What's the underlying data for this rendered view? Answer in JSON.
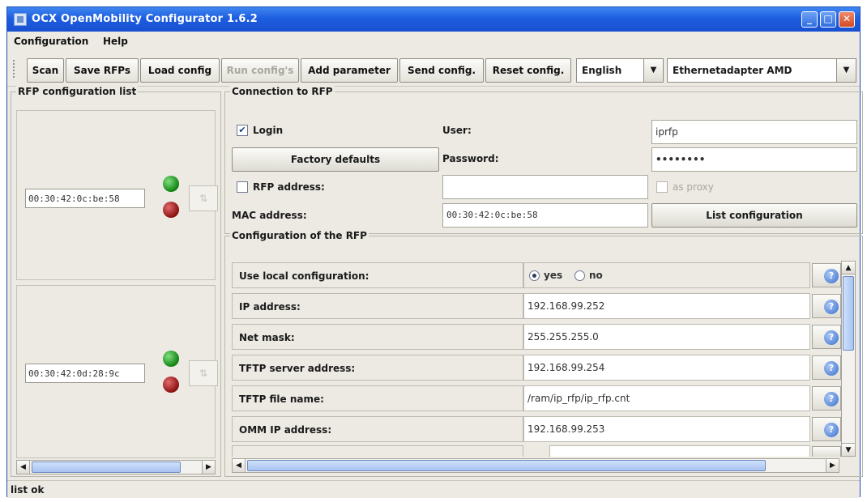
{
  "window": {
    "title": "OCX OpenMobility Configurator 1.6.2",
    "controls": {
      "minimize": "_",
      "maximize": "□",
      "close": "✕"
    }
  },
  "menu": {
    "items": [
      "Configuration",
      "Help"
    ]
  },
  "toolbar": {
    "buttons": [
      {
        "label": "Scan",
        "enabled": true
      },
      {
        "label": "Save RFPs",
        "enabled": true
      },
      {
        "label": "Load config",
        "enabled": true
      },
      {
        "label": "Run config's",
        "enabled": false
      },
      {
        "label": "Add parameter",
        "enabled": true
      },
      {
        "label": "Send config.",
        "enabled": true
      },
      {
        "label": "Reset config.",
        "enabled": true
      }
    ],
    "language": "English",
    "adapter": "Ethernetadapter AMD"
  },
  "rfp_list": {
    "legend": "RFP configuration list",
    "items": [
      {
        "mac": "00:30:42:0c:be:58"
      },
      {
        "mac": "00:30:42:0d:28:9c"
      }
    ]
  },
  "connection": {
    "legend": "Connection to RFP",
    "login_label": "Login",
    "login_checked": true,
    "factory_defaults_label": "Factory defaults",
    "user_label": "User:",
    "user_value": "iprfp",
    "password_label": "Password:",
    "password_value": "••••••••",
    "rfp_address_label": "RFP address:",
    "rfp_address_checked": false,
    "rfp_address_value": "",
    "as_proxy_label": "as proxy",
    "mac_label": "MAC address:",
    "mac_value": "00:30:42:0c:be:58",
    "list_config_label": "List configuration"
  },
  "rfp_config": {
    "legend": "Configuration of the RFP",
    "local_config": {
      "label": "Use local configuration:",
      "yes": "yes",
      "no": "no",
      "selected": "yes"
    },
    "rows": [
      {
        "label": "IP address:",
        "value": "192.168.99.252"
      },
      {
        "label": "Net mask:",
        "value": "255.255.255.0"
      },
      {
        "label": "TFTP server address:",
        "value": "192.168.99.254"
      },
      {
        "label": "TFTP file name:",
        "value": "/ram/ip_rfp/ip_rfp.cnt"
      },
      {
        "label": "OMM IP address:",
        "value": "192.168.99.253"
      }
    ],
    "help_glyph": "?"
  },
  "status": {
    "text": "list ok"
  },
  "icons": {
    "scroll_left": "◀",
    "scroll_right": "▶",
    "scroll_up": "▲",
    "scroll_down": "▼",
    "combo_arrow": "▼",
    "check": "✔"
  }
}
